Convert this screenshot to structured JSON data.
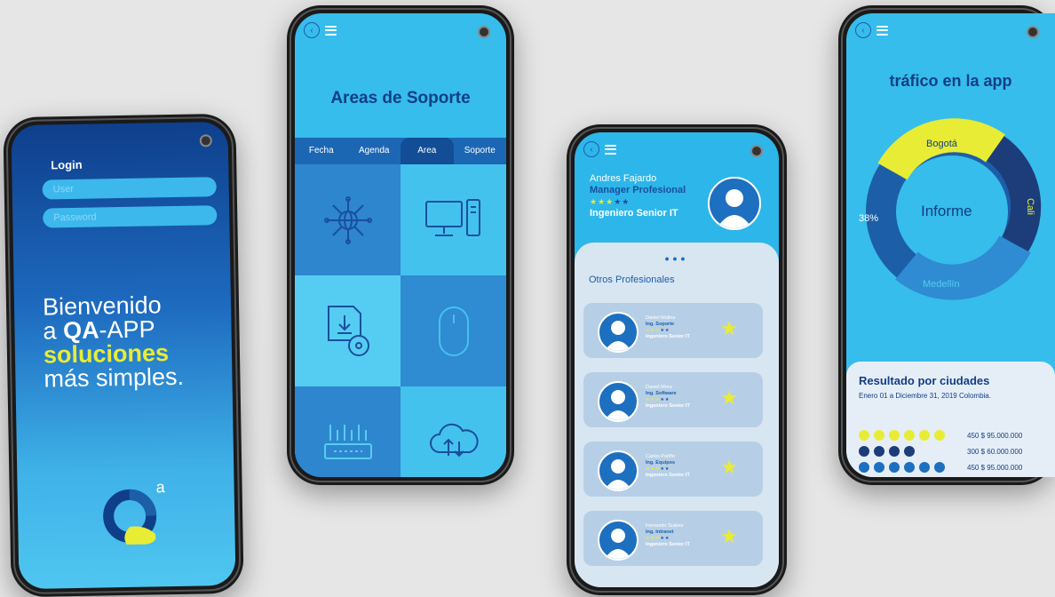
{
  "phone1": {
    "login_title": "Login",
    "user_placeholder": "User",
    "password_placeholder": "Password",
    "welcome_line1": "Bienvenido",
    "welcome_line2_prefix": "a ",
    "welcome_line2_bold": "QA",
    "welcome_line2_suffix": "-APP",
    "welcome_line3": "soluciones",
    "welcome_line4": "más simples.",
    "logo_sup": "a"
  },
  "phone2": {
    "title": "Areas de Soporte",
    "tabs": [
      "Fecha",
      "Agenda",
      "Area",
      "Soporte"
    ],
    "active_tab": "Area",
    "tiles": [
      "network-globe-icon",
      "desktop-computer-icon",
      "download-disc-icon",
      "mouse-icon",
      "router-icon",
      "cloud-sync-icon"
    ]
  },
  "phone3": {
    "profile": {
      "name": "Andres Fajardo",
      "title": "Manager Profesional",
      "stars_filled": 3,
      "stars_total": 5,
      "subtitle": "Ingeniero Senior IT"
    },
    "section_label": "Otros Profesionales",
    "cards": [
      {
        "name": "Daniel Molina",
        "role": "Ing. Soporte",
        "level": "Ingeniero Senior IT"
      },
      {
        "name": "Daniel Mora",
        "role": "Ing. Software",
        "level": "Ingeniero Senior IT"
      },
      {
        "name": "Carlos Patiño",
        "role": "Ing. Equipos",
        "level": "Ingeniero Senior IT"
      },
      {
        "name": "Fernando Suárez",
        "role": "Ing. Intranet",
        "level": "Ingeniero Senior IT"
      }
    ]
  },
  "phone4": {
    "title": "tráfico en la app",
    "center_label": "Informe",
    "segments": [
      {
        "label": "Bogotá",
        "color": "#e8ec35"
      },
      {
        "label": "Cali",
        "color": "#1c3d7a"
      },
      {
        "label": "Medellín",
        "color": "#2f8bd2"
      },
      {
        "label": "",
        "color": "#1d5ea8"
      }
    ],
    "percent_label": "38%",
    "results_title": "Resultado por ciudades",
    "results_subtitle": "Enero 01 a Diciembre 31, 2019 Colombia.",
    "rows": [
      {
        "dots": 6,
        "color": "#e8ec35",
        "value": "450 $ 95.000.000"
      },
      {
        "dots": 4,
        "color": "#1c3d7a",
        "value": "300 $ 60.000.000"
      },
      {
        "dots": 6,
        "color": "#1d6fc0",
        "value": "450 $ 95.000.000"
      }
    ]
  },
  "colors": {
    "accent_yellow": "#e8ec35",
    "navy": "#123e85",
    "sky": "#36bdeb"
  }
}
